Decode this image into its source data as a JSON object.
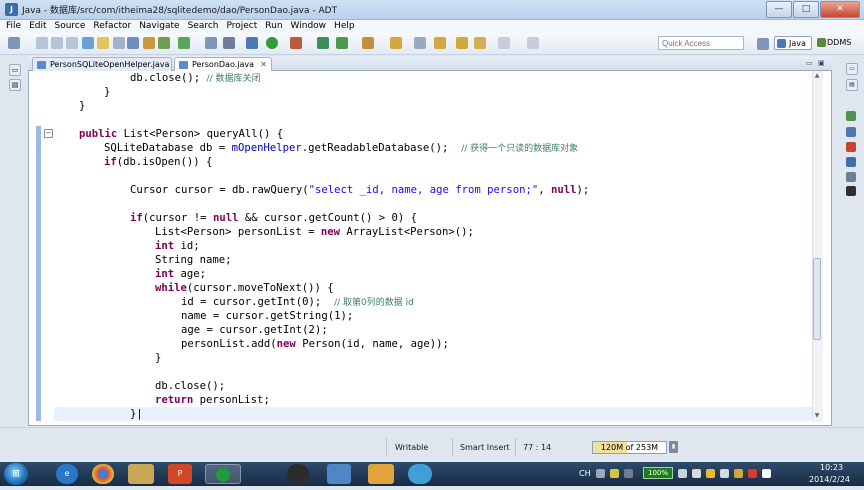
{
  "window": {
    "title": "Java - 数据库/src/com/itheima28/sqlitedemo/dao/PersonDao.java - ADT",
    "controls": {
      "minimize": "—",
      "maximize": "□",
      "close": "✕"
    }
  },
  "menu": [
    "File",
    "Edit",
    "Source",
    "Refactor",
    "Navigate",
    "Search",
    "Project",
    "Run",
    "Window",
    "Help"
  ],
  "toolbar": {
    "quick_access_placeholder": "Quick Access",
    "perspectives": [
      "Java",
      "DDMS"
    ]
  },
  "editor": {
    "tabs": [
      {
        "label": "PersonSQLiteOpenHelper.java",
        "active": false
      },
      {
        "label": "PersonDao.java",
        "active": true
      }
    ],
    "close_glyph": "✕",
    "min_glyph": "▭",
    "max_glyph": "▣"
  },
  "status": {
    "mode": "Writable",
    "insert": "Smart Insert",
    "position": "77 : 14",
    "heap": "120M of 253M",
    "heap_used_fraction": 0.47
  },
  "taskbar": {
    "battery": "100%",
    "ime": "CH",
    "time": "10:23",
    "date": "2014/2/24"
  },
  "colors": {
    "keyword": "#7f0055",
    "string": "#2a00ff",
    "field": "#0000c0",
    "comment": "#3f7f5f",
    "current_line": "#e8f2fe"
  }
}
